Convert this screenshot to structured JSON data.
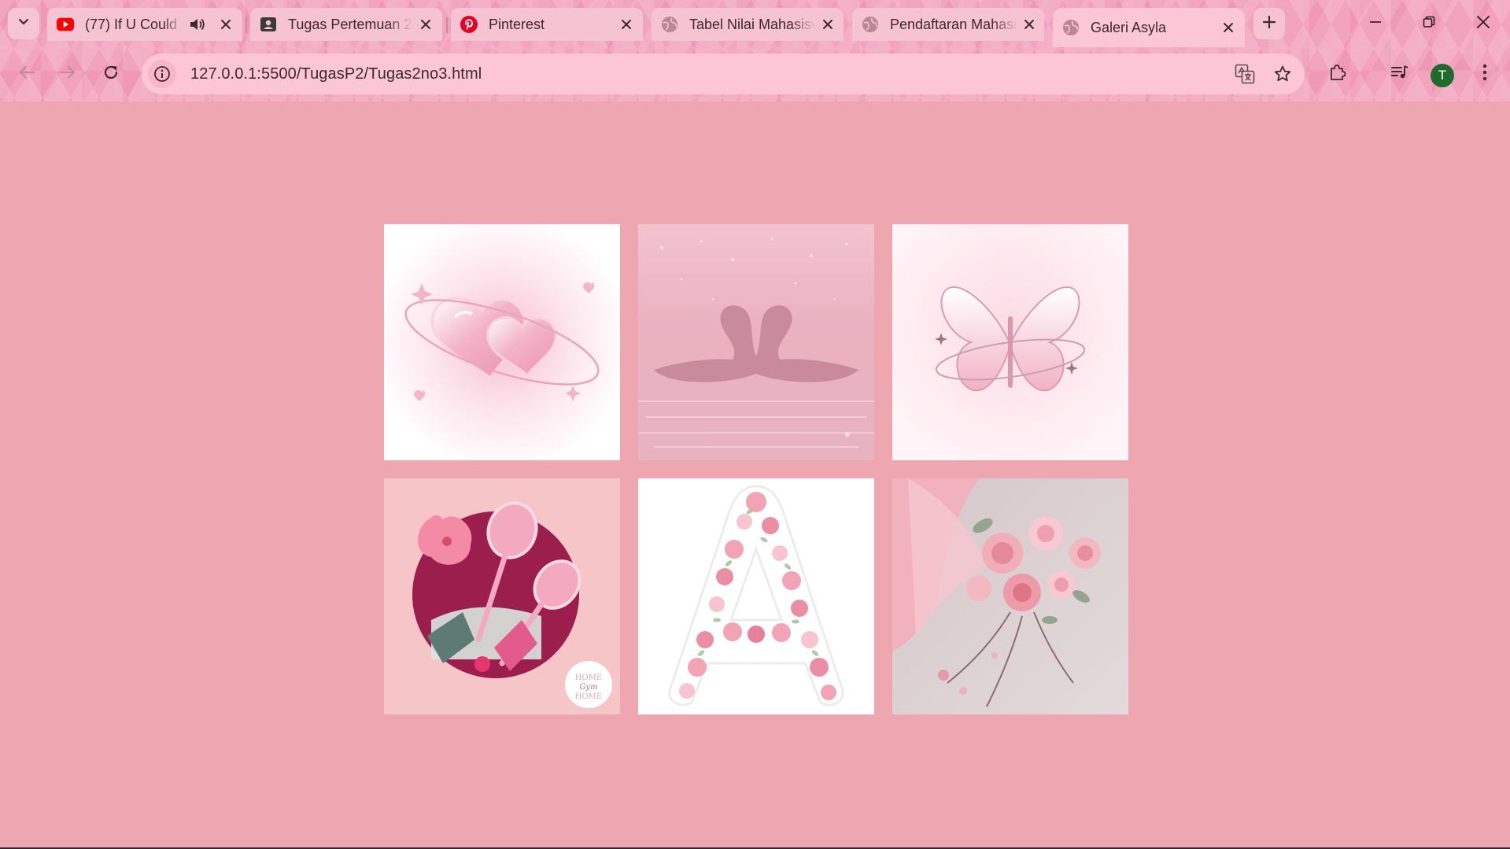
{
  "browser": {
    "tabs": [
      {
        "title": "(77) If U Could",
        "icon": "youtube-icon",
        "audio": true,
        "active": false
      },
      {
        "title": "Tugas Pertemuan 2",
        "icon": "classroom-icon",
        "audio": false,
        "active": false
      },
      {
        "title": "Pinterest",
        "icon": "pinterest-icon",
        "audio": false,
        "active": false
      },
      {
        "title": "Tabel Nilai Mahasiswa",
        "icon": "globe-icon",
        "audio": false,
        "active": false
      },
      {
        "title": "Pendaftaran Mahasiswa",
        "icon": "globe-icon",
        "audio": false,
        "active": false
      },
      {
        "title": "Galeri Asyla",
        "icon": "globe-icon",
        "audio": false,
        "active": true
      }
    ],
    "address": "127.0.0.1:5500/TugasP2/Tugas2no3.html",
    "profile_initial": "T",
    "colors": {
      "chrome": "#f2a3bd",
      "omnibox": "#fcc6d6",
      "page_bg": "#eea7b0",
      "profile": "#1f6b2c"
    }
  },
  "gallery": {
    "images": [
      {
        "subject": "glossy pink hearts with orbit ring"
      },
      {
        "subject": "two swans forming a heart on pink water"
      },
      {
        "subject": "pink glossy butterfly with orbit ring"
      },
      {
        "subject": "badminton rackets, shuttlecocks and hibiscus",
        "stamp_text": "HOME Gym HOME"
      },
      {
        "subject": "letter A made of pink flowers"
      },
      {
        "subject": "pink rose bouquet on grey surface"
      }
    ]
  }
}
